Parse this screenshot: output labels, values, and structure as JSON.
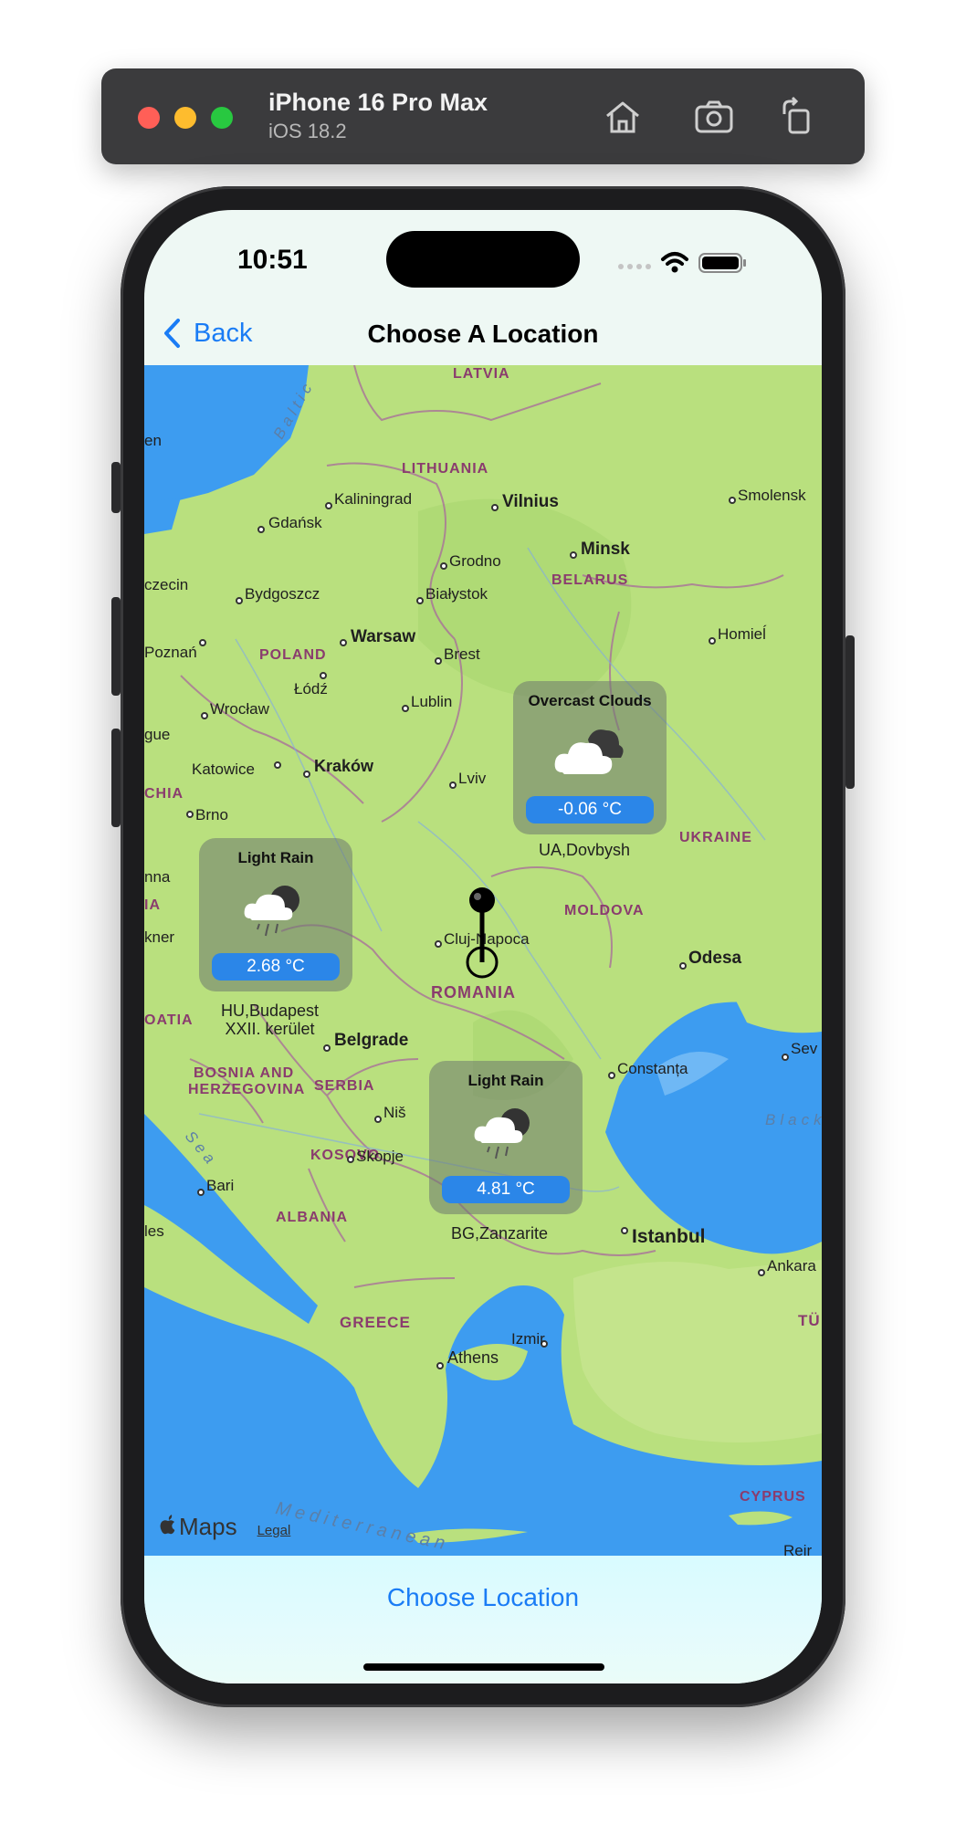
{
  "simulator": {
    "device": "iPhone 16 Pro Max",
    "os": "iOS 18.2",
    "icons": [
      "home-icon",
      "screenshot-icon",
      "rotate-icon"
    ]
  },
  "status_bar": {
    "time": "10:51",
    "icons": [
      "cellular-icon",
      "wifi-icon",
      "battery-icon"
    ]
  },
  "nav": {
    "back_label": "Back",
    "title": "Choose A Location"
  },
  "map": {
    "countries": [
      "LATVIA",
      "LITHUANIA",
      "BELARUS",
      "POLAND",
      "UKRAINE",
      "MOLDOVA",
      "ROMANIA",
      "BOSNIA AND",
      "HERZEGOVINA",
      "SERBIA",
      "KOSOVO",
      "ALBANIA",
      "GREECE",
      "TÜ",
      "CYPRUS",
      "CHIA",
      "IA",
      "OATIA"
    ],
    "cities": [
      "Kaliningrad",
      "Vilnius",
      "Smolensk",
      "Gdańsk",
      "Minsk",
      "Grodno",
      "Białystok",
      "Bydgoszcz",
      "Poznań",
      "Warsaw",
      "Brest",
      "Homieĺ",
      "Łódź",
      "Wrocław",
      "Lublin",
      "Katowice",
      "Kraków",
      "Lviv",
      "Brno",
      "Cluj-Napoca",
      "Odesa",
      "Belgrade",
      "Constanța",
      "Niš",
      "Skopje",
      "Bari",
      "Istanbul",
      "Ankara",
      "Izmir",
      "Athens",
      "Sev",
      "Reir",
      "en",
      "czecin",
      "gue",
      "nna",
      "kner",
      "les"
    ],
    "seas": [
      "Baltic",
      "Black",
      "Sea",
      "Mediterranean"
    ],
    "attribution": "Maps",
    "legal": "Legal"
  },
  "weather_cards": [
    {
      "condition": "Overcast Clouds",
      "temperature": "-0.06 °C",
      "location": "UA,Dovbysh",
      "icon": "cloud-icon"
    },
    {
      "condition": "Light Rain",
      "temperature": "2.68 °C",
      "location": "HU,Budapest XXII. kerület",
      "location_line1": "HU,Budapest",
      "location_line2": "XXII. kerület",
      "icon": "rain-cloud-icon"
    },
    {
      "condition": "Light Rain",
      "temperature": "4.81 °C",
      "location": "BG,Zanzarite",
      "icon": "rain-cloud-icon"
    }
  ],
  "bottom": {
    "choose_label": "Choose Location"
  },
  "colors": {
    "accent": "#1a7cf5",
    "temp_badge": "#2b86e8",
    "land": "#b9e07e",
    "water": "#3d9cf0",
    "border": "#a86a9c"
  }
}
